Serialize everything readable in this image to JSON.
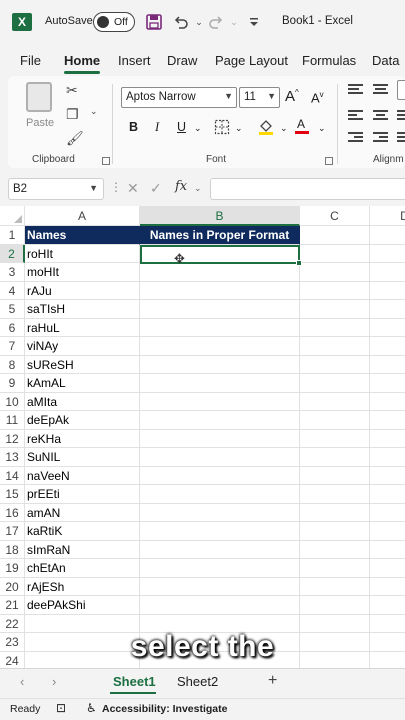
{
  "titlebar": {
    "logo": "X",
    "autosave_label": "AutoSave",
    "autosave_state": "Off",
    "doc_title": "Book1  -  Excel",
    "icons": [
      "save-icon",
      "undo-icon",
      "redo-icon",
      "customize-icon"
    ]
  },
  "tabs": [
    "File",
    "Home",
    "Insert",
    "Draw",
    "Page Layout",
    "Formulas",
    "Data"
  ],
  "active_tab": "Home",
  "ribbon": {
    "clipboard": {
      "paste_label": "Paste",
      "group_label": "Clipboard"
    },
    "font": {
      "font_name": "Aptos Narrow",
      "font_size": "11",
      "grow": "A",
      "shrink": "A",
      "bold": "B",
      "italic": "I",
      "underline": "U",
      "group_label": "Font"
    },
    "alignment": {
      "group_label": "Alignm"
    }
  },
  "formula_bar": {
    "name_box": "B2",
    "fx": "fx",
    "formula": ""
  },
  "grid": {
    "columns": [
      "A",
      "B",
      "C",
      "D"
    ],
    "rows": [
      "1",
      "2",
      "3",
      "4",
      "5",
      "6",
      "7",
      "8",
      "9",
      "10",
      "11",
      "12",
      "13",
      "14",
      "15",
      "16",
      "17",
      "18",
      "19",
      "20",
      "21",
      "22",
      "23",
      "24"
    ],
    "header_row": {
      "a": "Names",
      "b": "Names in Proper Format"
    },
    "names": [
      "roHIt",
      "moHIt",
      "rAJu",
      "saTIsH",
      "raHuL",
      "viNAy",
      "sUReSH",
      "kAmAL",
      "aMIta",
      "deEpAk",
      "reKHa",
      "SuNIL",
      "naVeeN",
      "prEEti",
      "amAN",
      "kaRtiK",
      "sImRaN",
      "chEtAn",
      "rAjESh",
      "deePAkShi"
    ],
    "selected_cell": "B2",
    "header_fill": "#0f2a5c"
  },
  "caption": "select the",
  "sheets": [
    "Sheet1",
    "Sheet2"
  ],
  "active_sheet": "Sheet1",
  "status": {
    "ready": "Ready",
    "accessibility": "Accessibility: Investigate"
  },
  "colors": {
    "accent": "#1d6f42",
    "header_fill": "#0f2a5c"
  }
}
